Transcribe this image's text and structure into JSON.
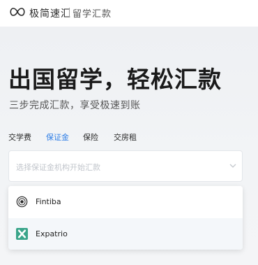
{
  "header": {
    "logo_icon": "infinity-icon",
    "brand": "极简速汇",
    "subbrand": "留学汇款"
  },
  "hero": {
    "headline": "出国留学，轻松汇款",
    "tagline": "三步完成汇款，享受极速到账"
  },
  "tabs": [
    {
      "label": "交学费",
      "active": false
    },
    {
      "label": "保证金",
      "active": true
    },
    {
      "label": "保险",
      "active": false
    },
    {
      "label": "交房租",
      "active": false
    }
  ],
  "select": {
    "placeholder": "选择保证金机构开始汇款",
    "chevron_icon": "chevron-down-icon"
  },
  "dropdown": {
    "options": [
      {
        "label": "Fintiba",
        "icon": "fintiba-logo-icon"
      },
      {
        "label": "Expatrio",
        "icon": "expatrio-logo-icon"
      }
    ]
  },
  "colors": {
    "accent": "#2f7ee6",
    "expatrio": "#3aa58a"
  }
}
